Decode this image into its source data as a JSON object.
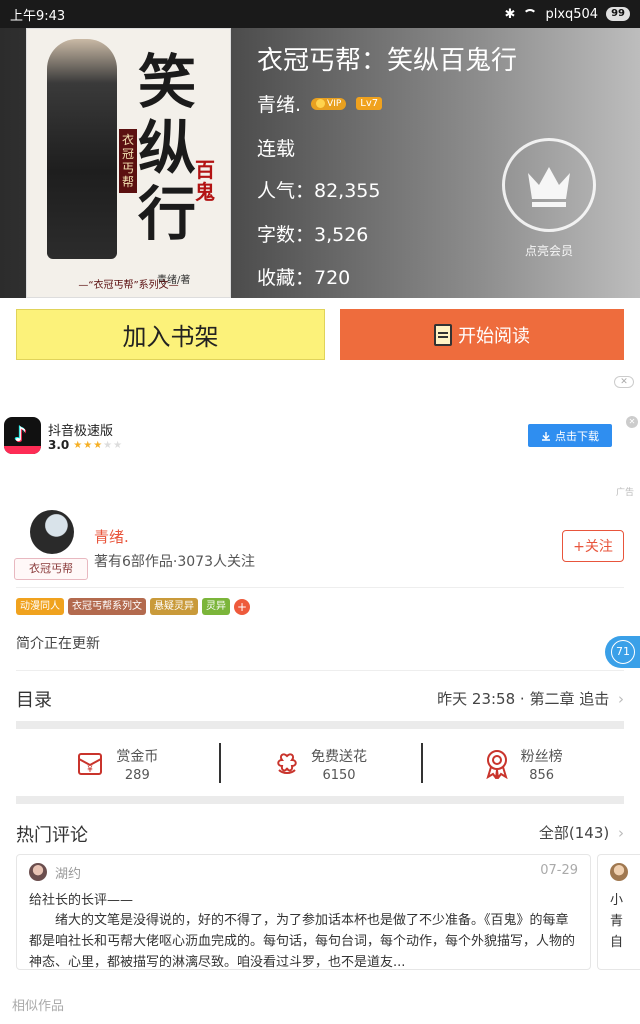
{
  "status_bar": {
    "time": "上午9:43",
    "bluetooth": "✱",
    "carrier": "plxq504",
    "battery": "99"
  },
  "book": {
    "title": "衣冠丐帮：笑纵百鬼行",
    "author": "青绪.",
    "vip": "VIP",
    "level": "Lv7",
    "status": "连载",
    "popularity": "人气：82,355",
    "words": "字数：3,526",
    "favorites": "收藏：720",
    "member_label": "点亮会员"
  },
  "cover": {
    "big_title": "笑纵行",
    "red_title": "百鬼",
    "vert_tag": "衣冠丐帮",
    "author": "青绪/著",
    "series": "—“衣冠丐帮”系列文—"
  },
  "actions": {
    "add_shelf": "加入书架",
    "start_read": "开始阅读"
  },
  "ad": {
    "close": "✕",
    "app_name": "抖音极速版",
    "rating": "3.0",
    "download": "点击下载",
    "label": "广告"
  },
  "author_card": {
    "name": "青绪.",
    "meta": "著有6部作品·3073人关注",
    "avatar_tag": "衣冠丐帮",
    "follow": "+关注"
  },
  "tags": [
    {
      "label": "动漫同人",
      "color": "#f0a21e"
    },
    {
      "label": "衣冠丐帮系列文",
      "color": "#b36a4e"
    },
    {
      "label": "悬疑灵异",
      "color": "#c99a3a"
    },
    {
      "label": "灵异",
      "color": "#7bb53a"
    }
  ],
  "intro": "简介正在更新",
  "float_count": "71",
  "toc": {
    "title": "目录",
    "latest": "昨天 23:58 · 第二章 追击"
  },
  "stats": [
    {
      "label": "赏金币",
      "value": "289"
    },
    {
      "label": "免费送花",
      "value": "6150"
    },
    {
      "label": "粉丝榜",
      "value": "856"
    }
  ],
  "comments": {
    "title": "热门评论",
    "all": "全部(143)",
    "items": [
      {
        "user": "湖约",
        "date": "07-29",
        "heading": "给社长的长评——",
        "body": "绪大的文笔是没得说的，好的不得了，为了参加话本杯也是做了不少准备。《百鬼》的每章都是咱社长和丐帮大佬呕心沥血完成的。每句话，每句台词，每个动作，每个外貌描写，人物的神态、心里，都被描写的淋漓尽致。咱没看过斗罗，也不是道友..."
      }
    ],
    "peek_lines": [
      "小",
      "青",
      "自"
    ]
  },
  "similar": "相似作品",
  "colors": {
    "accent": "#ee6c3d",
    "shelf": "#fcf27a",
    "author": "#e8553c"
  }
}
